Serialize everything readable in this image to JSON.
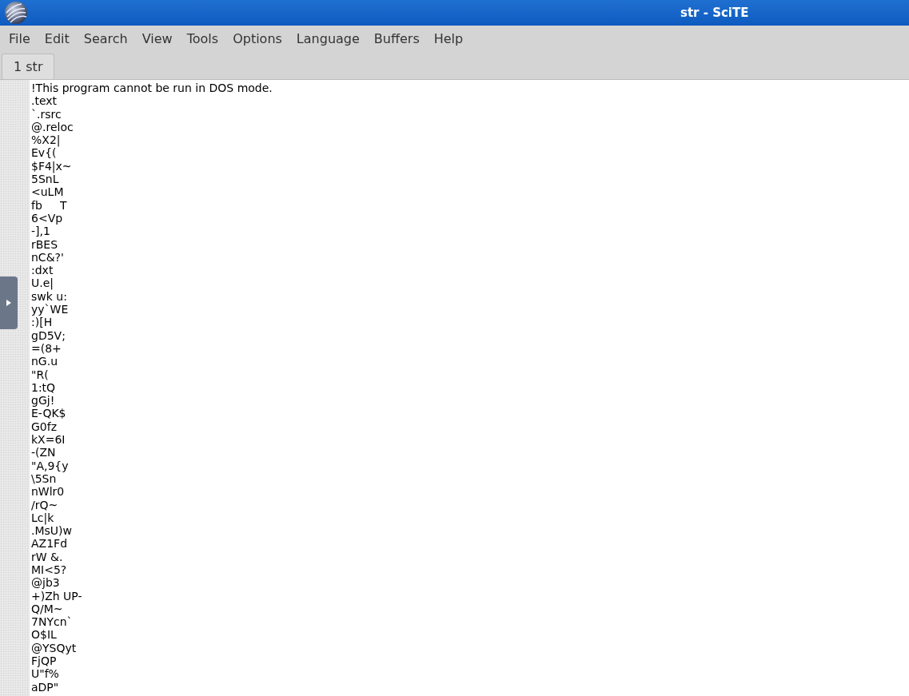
{
  "window": {
    "title": "str - SciTE"
  },
  "menu": [
    "File",
    "Edit",
    "Search",
    "View",
    "Tools",
    "Options",
    "Language",
    "Buffers",
    "Help"
  ],
  "tabs": [
    {
      "label": "1 str",
      "selected": true
    }
  ],
  "editor": {
    "lines": [
      "!This program cannot be run in DOS mode.",
      ".text",
      "`.rsrc",
      "@.reloc",
      "%X2|",
      "Ev{(",
      "$F4|x~",
      "5SnL",
      "<uLM",
      "fb     T",
      "6<Vp",
      "-],1",
      "rBES",
      "nC&?'",
      ":dxt",
      "U.e|",
      "swk u:",
      "yy`WE",
      ":)[H",
      "gD5V;",
      "=(8+",
      "nG.u",
      "\"R(",
      "1:tQ",
      "gGj!",
      "E-QK$",
      "G0fz",
      "kX=6I",
      "-(ZN",
      "\"A,9{y",
      "\\5Sn",
      "nWlr0",
      "/rQ~",
      "Lc|k",
      ".MsU)w",
      "AZ1Fd",
      "rW &.",
      "MI<5?",
      "@jb3",
      "+)Zh UP-",
      "Q/M~",
      "7NYcn`",
      "O$IL",
      "@YSQyt",
      "FjQP",
      "U\"f%",
      "aDP\""
    ]
  }
}
